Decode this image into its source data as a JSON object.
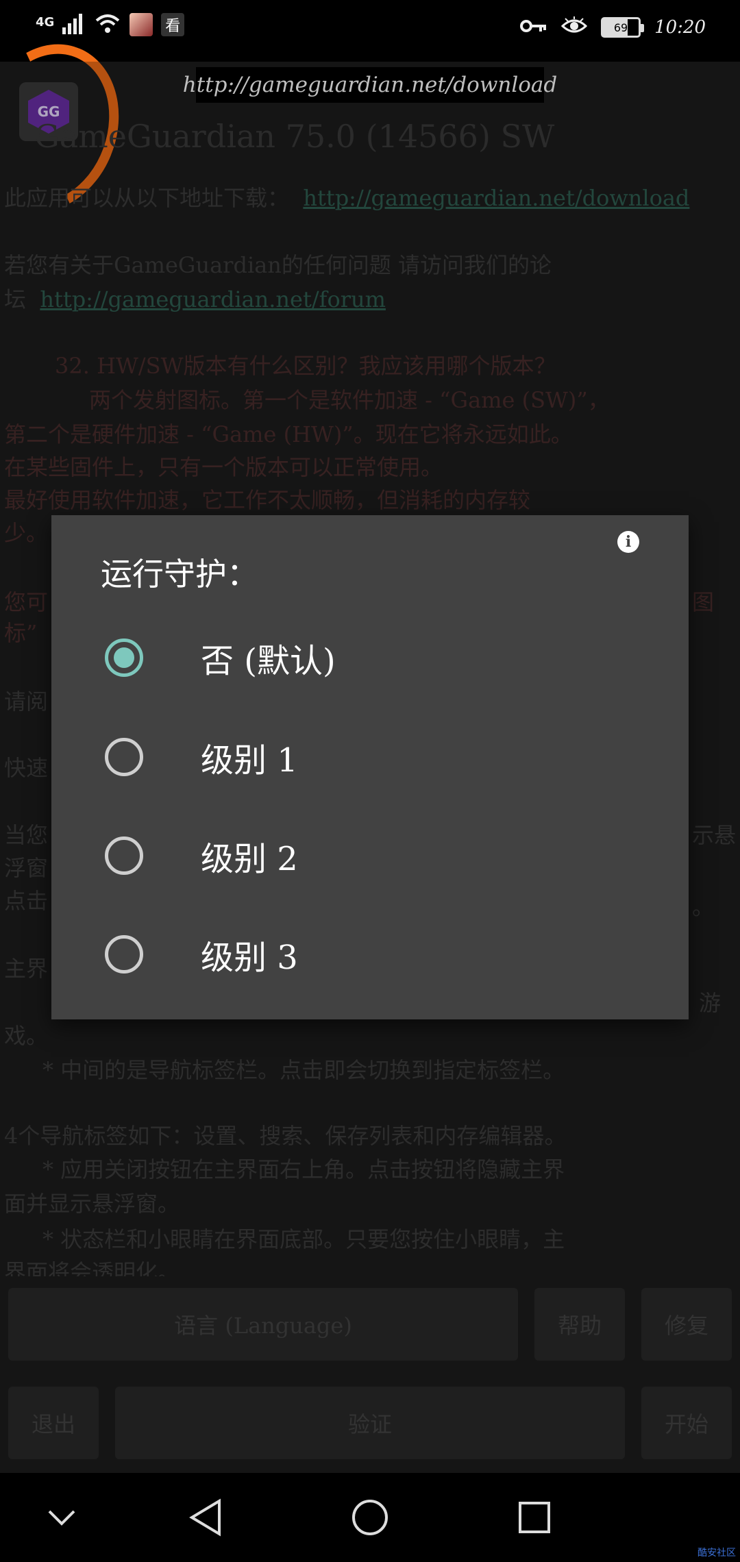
{
  "status_bar": {
    "network": "4G",
    "newsapp_glyph": "看",
    "battery": "69",
    "time": "10:20",
    "icons": [
      "signal-icon",
      "wifi-icon",
      "avatar-icon",
      "news-app-icon",
      "key-icon",
      "eye-icon",
      "battery-icon"
    ]
  },
  "app": {
    "url_banner": "http://gameguardian.net/download",
    "logo_text": "GG",
    "title": "GameGuardian 75.0 (14566) SW",
    "lines": [
      {
        "text": "此应用可以从以下地址下载：",
        "link": "http://gameguardian.net/download"
      },
      {
        "text": "若您有关于GameGuardian的任何问题 请访问我们的论"
      },
      {
        "text": "坛",
        "link": "http://gameguardian.net/forum"
      },
      {
        "text": "32. HW/SW版本有什么区别？我应该用哪个版本？"
      },
      {
        "text": "两个发射图标。第一个是软件加速 - “Game (SW)”，"
      },
      {
        "text": "第二个是硬件加速 - “Game (HW)”。现在它将永远如此。"
      },
      {
        "text": "在某些固件上，只有一个版本可以正常使用。"
      },
      {
        "text": "最好使用软件加速，它工作不太顺畅，但消耗的内存较"
      },
      {
        "text": "少。"
      },
      {
        "text": "您可"
      },
      {
        "text": "标”"
      },
      {
        "text": "请阅"
      },
      {
        "text": "快速"
      },
      {
        "text": "当您"
      },
      {
        "text": "浮窗"
      },
      {
        "text": "点击"
      },
      {
        "text": "主界"
      },
      {
        "text": "戏。"
      },
      {
        "text": "* 中间的是导航标签栏。点击即会切换到指定标签栏。"
      },
      {
        "text": "4个导航标签如下：设置、搜索、保存列表和内存编辑器。"
      },
      {
        "text": "* 应用关闭按钮在主界面右上角。点击按钮将隐藏主界"
      },
      {
        "text": "面并显示悬浮窗。"
      },
      {
        "text": "* 状态栏和小眼睛在界面底部。只要您按住小眼睛，主"
      },
      {
        "text": "界面将会透明化。"
      }
    ],
    "fragments_right": [
      "图",
      "示悬",
      "。",
      "游"
    ],
    "buttons": {
      "language": "语言 (Language)",
      "help": "帮助",
      "repair": "修复",
      "exit": "退出",
      "verify": "验证",
      "start": "开始"
    }
  },
  "dialog": {
    "title": "运行守护：",
    "info_glyph": "i",
    "options": [
      {
        "label": "否 (默认)",
        "checked": true
      },
      {
        "label": "级别 1",
        "checked": false
      },
      {
        "label": "级别 2",
        "checked": false
      },
      {
        "label": "级别 3",
        "checked": false
      }
    ]
  },
  "nav_bar": {
    "buttons": [
      "chevron-down-icon",
      "back-icon",
      "home-icon",
      "recents-icon"
    ],
    "watermark": "酷安社区"
  }
}
